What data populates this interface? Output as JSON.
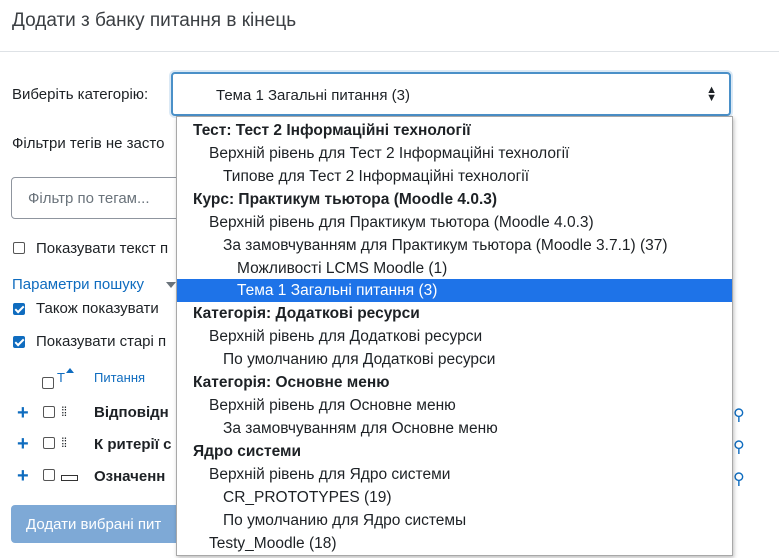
{
  "page": {
    "title": "Додати з банку питання в кінець"
  },
  "category_select": {
    "label": "Виберіть категорію:",
    "value": "Тема 1 Загальні питання (3)"
  },
  "tag_filters": {
    "notice": "Фільтри тегів не засто",
    "placeholder": "Фільтр по тегам..."
  },
  "options": {
    "show_text": "Показувати текст п",
    "show_text_checked": false,
    "search_params_link": "Параметри пошуку",
    "also_show": "Також показувати",
    "also_show_checked": true,
    "show_old": "Показувати старі п",
    "show_old_checked": true
  },
  "table": {
    "col_t": "Т",
    "col_question": "Питання",
    "rows": [
      {
        "name": "Відповідн",
        "checked": false,
        "icon": "drag-grid-icon"
      },
      {
        "name": "К ритерії с",
        "checked": false,
        "icon": "drag-grid-icon"
      },
      {
        "name": "Означенн",
        "checked": false,
        "icon": "description-icon"
      }
    ]
  },
  "add_button": "Додати вибрані пит",
  "dropdown": {
    "items": [
      {
        "text": "Тест: Тест 2 Інформаційні технології",
        "type": "group",
        "level": 0
      },
      {
        "text": "Верхній рівень для Тест 2 Інформаційні технології",
        "type": "option",
        "level": 1
      },
      {
        "text": "Типове для Тест 2 Інформаційні технології",
        "type": "option",
        "level": 2
      },
      {
        "text": "Курс: Практикум тьютора (Moodle 4.0.3)",
        "type": "group",
        "level": 0
      },
      {
        "text": "Верхній рівень для Практикум тьютора (Moodle 4.0.3)",
        "type": "option",
        "level": 1
      },
      {
        "text": "За замовчуванням для Практикум тьютора (Moodle 3.7.1) (37)",
        "type": "option",
        "level": 2
      },
      {
        "text": "Можливості LCMS Moodle (1)",
        "type": "option",
        "level": 3
      },
      {
        "text": "Тема 1 Загальні питання (3)",
        "type": "option",
        "level": 3,
        "selected": true
      },
      {
        "text": "Категорія: Додаткові ресурси",
        "type": "group",
        "level": 0
      },
      {
        "text": "Верхній рівень для Додаткові ресурси",
        "type": "option",
        "level": 1
      },
      {
        "text": "По умолчанию для Додаткові ресурси",
        "type": "option",
        "level": 2
      },
      {
        "text": "Категорія: Основне меню",
        "type": "group",
        "level": 0
      },
      {
        "text": "Верхній рівень для Основне меню",
        "type": "option",
        "level": 1
      },
      {
        "text": "За замовчуванням для Основне меню",
        "type": "option",
        "level": 2
      },
      {
        "text": "Ядро системи",
        "type": "group",
        "level": 0
      },
      {
        "text": "Верхній рівень для Ядро системи",
        "type": "option",
        "level": 1
      },
      {
        "text": "CR_PROTOTYPES (19)",
        "type": "option",
        "level": 2
      },
      {
        "text": "По умолчанию для Ядро системы",
        "type": "option",
        "level": 2
      },
      {
        "text": "Testy_Moodle (18)",
        "type": "option",
        "level": 1
      }
    ]
  }
}
